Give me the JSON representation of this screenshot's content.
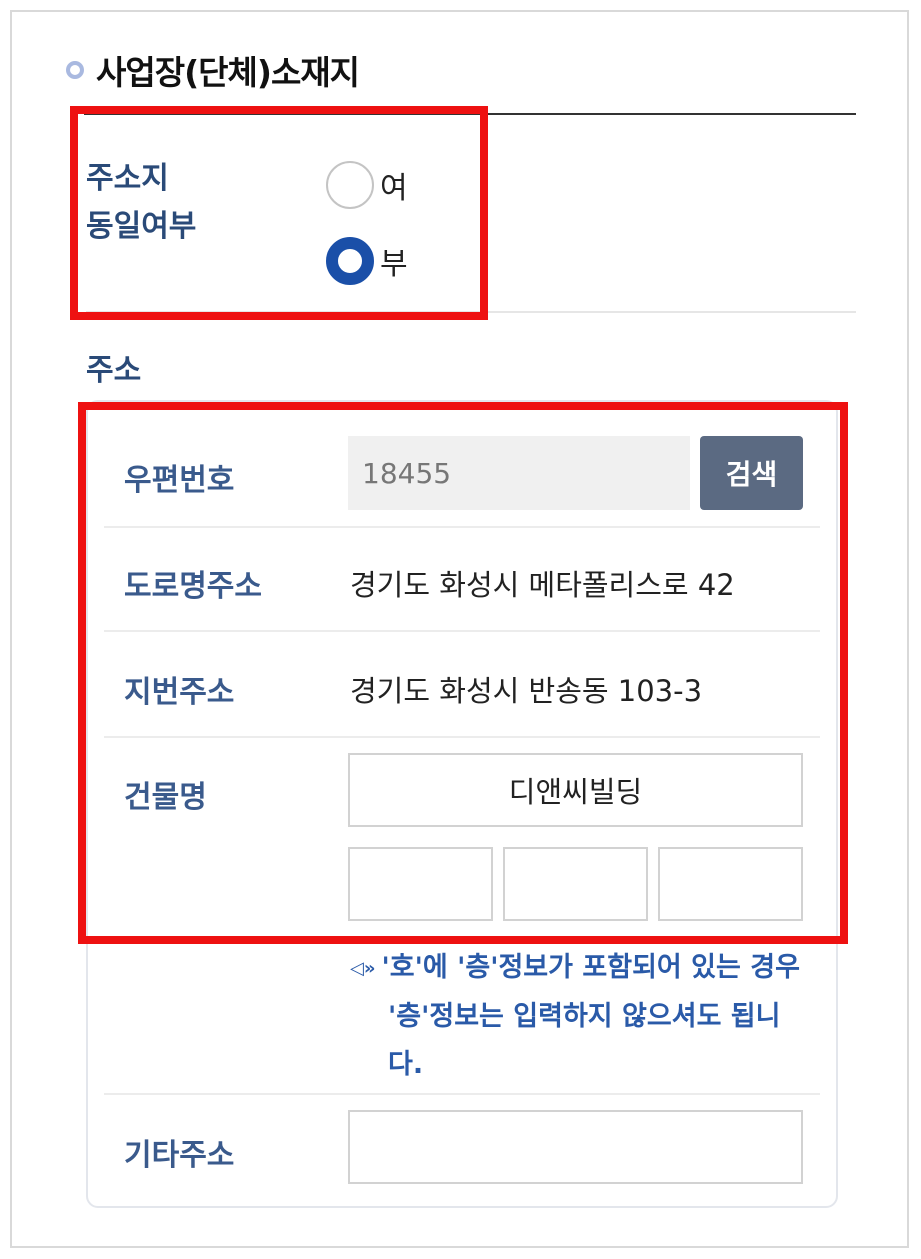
{
  "section": {
    "title": "사업장(단체)소재지"
  },
  "same_address": {
    "label_line1": "주소지",
    "label_line2": "동일여부",
    "options": [
      {
        "label": "여",
        "checked": false
      },
      {
        "label": "부",
        "checked": true
      }
    ]
  },
  "address": {
    "label": "주소",
    "postal_label": "우편번호",
    "postal_value": "18455",
    "search_label": "검색",
    "road_label": "도로명주소",
    "road_value": "경기도 화성시 메타폴리스로 42",
    "jibun_label": "지번주소",
    "jibun_value": "경기도 화성시 반송동 103-3",
    "building_label": "건물명",
    "building_value": "디앤씨빌딩",
    "dong_value": "",
    "floor_value": "",
    "ho_value": "",
    "notice_line1": "'호'에 '층'정보가 포함되어 있는 경우",
    "notice_line2": "'층'정보는 입력하지 않으셔도 됩니",
    "notice_line3": "다.",
    "etc_label": "기타주소",
    "etc_value": ""
  },
  "colors": {
    "highlight": "#ee1111",
    "radio_checked": "#1a4fa8",
    "label_blue": "#3a5a8c",
    "search_button": "#5b6a82",
    "notice_blue": "#2a5aa8"
  },
  "icons": {
    "section_bullet": "ring-dot-icon",
    "notice": "speaker-icon"
  }
}
